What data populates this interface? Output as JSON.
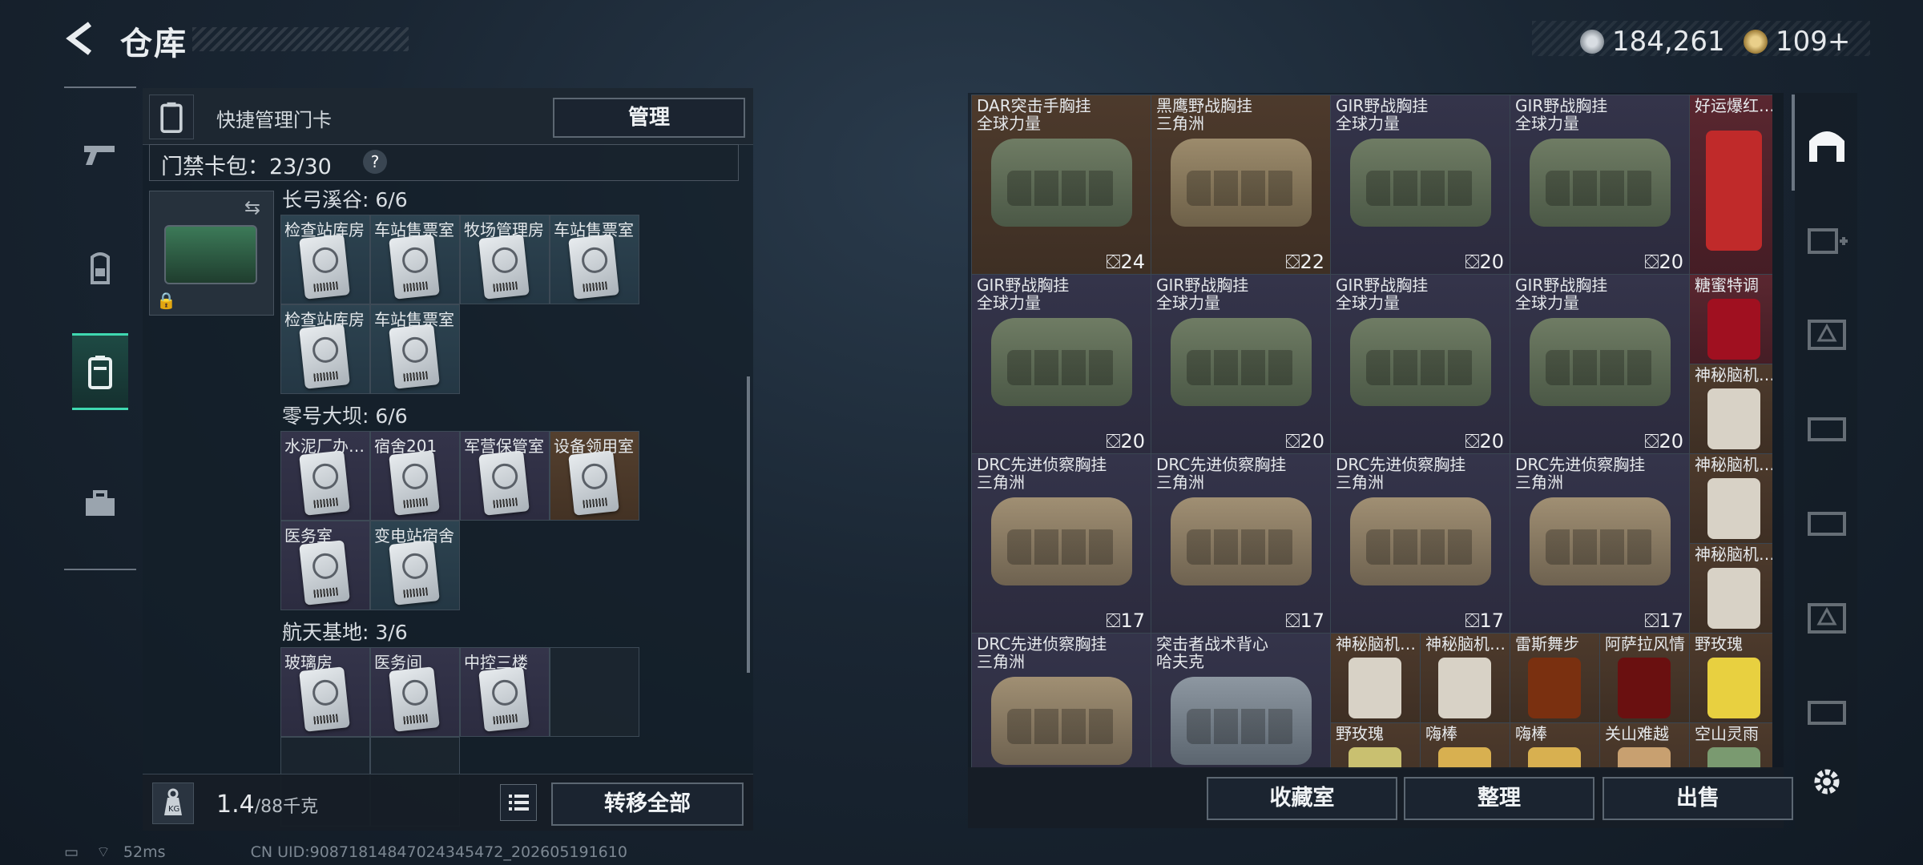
{
  "header": {
    "title": "仓库"
  },
  "currency": {
    "coins": "184,261",
    "gold": "109+"
  },
  "left_nav": {
    "items": [
      "weapon",
      "backpack",
      "keycard",
      "toolbox"
    ],
    "active": "keycard"
  },
  "keycard_panel": {
    "title": "快捷管理门卡",
    "manage_label": "管理",
    "pack_count_label": "门禁卡包：23/30",
    "help_label": "?",
    "sections": [
      {
        "title": "长弓溪谷: 6/6",
        "cards": [
          "检查站库房",
          "车站售票室",
          "牧场管理房",
          "车站售票室",
          "检查站库房",
          "车站售票室"
        ]
      },
      {
        "title": "零号大坝: 6/6",
        "cards": [
          "水泥厂办…",
          "宿舍201",
          "军营保管室",
          "设备领用室",
          "医务室",
          "变电站宿舍"
        ]
      },
      {
        "title": "航天基地: 3/6",
        "cards": [
          "玻璃房",
          "医务间",
          "中控三楼"
        ]
      }
    ],
    "weight": "1.4",
    "weight_max": "/88千克",
    "transfer_label": "转移全部"
  },
  "inventory": {
    "large": [
      {
        "name1": "DAR突击手胸挂",
        "name2": "全球力量",
        "qty": "24"
      },
      {
        "name1": "黑鹰野战胸挂",
        "name2": "三角洲",
        "qty": "22"
      },
      {
        "name1": "GIR野战胸挂",
        "name2": "全球力量",
        "qty": "20"
      },
      {
        "name1": "GIR野战胸挂",
        "name2": "全球力量",
        "qty": "20"
      },
      {
        "name1": "GIR野战胸挂",
        "name2": "全球力量",
        "qty": "20"
      },
      {
        "name1": "GIR野战胸挂",
        "name2": "全球力量",
        "qty": "20"
      },
      {
        "name1": "GIR野战胸挂",
        "name2": "全球力量",
        "qty": "20"
      },
      {
        "name1": "GIR野战胸挂",
        "name2": "全球力量",
        "qty": "20"
      },
      {
        "name1": "DRC先进侦察胸挂",
        "name2": "三角洲",
        "qty": "17"
      },
      {
        "name1": "DRC先进侦察胸挂",
        "name2": "三角洲",
        "qty": "17"
      },
      {
        "name1": "DRC先进侦察胸挂",
        "name2": "三角洲",
        "qty": "17"
      },
      {
        "name1": "DRC先进侦察胸挂",
        "name2": "三角洲",
        "qty": "17"
      },
      {
        "name1": "DRC先进侦察胸挂",
        "name2": "三角洲",
        "qty": ""
      },
      {
        "name1": "突击者战术背心",
        "name2": "哈夫克",
        "qty": ""
      }
    ],
    "small": [
      "好运爆红…",
      "糖蜜特调",
      "神秘脑机…",
      "神秘脑机…",
      "神秘脑机…",
      "神秘脑机…",
      "神秘脑机…",
      "雷斯舞步",
      "阿萨拉风情",
      "野玫瑰",
      "野玫瑰",
      "嗨棒",
      "嗨棒",
      "关山难越",
      "空山灵雨"
    ],
    "footer": {
      "collection": "收藏室",
      "sort": "整理",
      "sell": "出售"
    }
  },
  "status": {
    "ping": "52ms",
    "uid": "CN UID:9087181484702434​5472_202605191610"
  }
}
